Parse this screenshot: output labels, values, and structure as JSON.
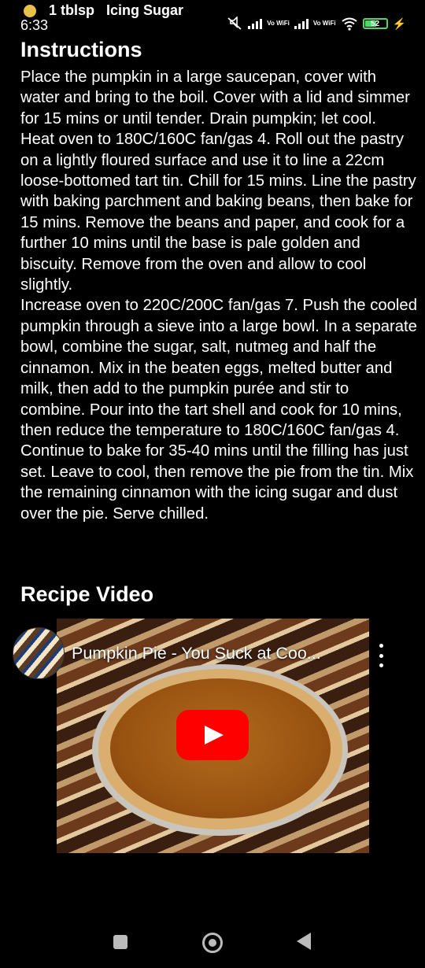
{
  "status_bar": {
    "time": "6:33",
    "notification_text": {
      "quantity": "1 tblsp",
      "item": "Icing Sugar"
    },
    "vowifi_label_1": "Vo WiFi",
    "vowifi_label_2": "Vo WiFi",
    "battery_level": "52",
    "icons": [
      "notification-dot",
      "mute-icon",
      "signal-icon",
      "signal-icon",
      "wifi-icon",
      "battery-icon",
      "charging-icon"
    ]
  },
  "instructions": {
    "title": "Instructions",
    "steps": [
      "Place the pumpkin in a large saucepan, cover with water and bring to the boil. Cover with a lid and simmer for 15 mins or until tender. Drain pumpkin; let cool.",
      "Heat oven to 180C/160C fan/gas 4. Roll out the pastry on a lightly floured surface and use it to line a 22cm loose-bottomed tart tin. Chill for 15 mins. Line the pastry with baking parchment and baking beans, then bake for 15 mins. Remove the beans and paper, and cook for a further 10 mins until the base is pale golden and biscuity. Remove from the oven and allow to cool slightly.",
      "Increase oven to 220C/200C fan/gas 7. Push the cooled pumpkin through a sieve into a large bowl. In a separate bowl, combine the sugar, salt, nutmeg and half the cinnamon. Mix in the beaten eggs, melted butter and milk, then add to the pumpkin purée and stir to combine. Pour into the tart shell and cook for 10 mins, then reduce the temperature to 180C/160C fan/gas 4. Continue to bake for 35-40 mins until the filling has just set. Leave to cool, then remove the pie from the tin. Mix the remaining cinnamon with the icing sugar and dust over the pie. Serve chilled."
    ]
  },
  "recipe_video": {
    "title": "Recipe Video",
    "video_title": "Pumpkin Pie - You Suck at Coo...",
    "icons": [
      "channel-avatar",
      "play-icon",
      "more-vert-icon"
    ]
  },
  "navigation": {
    "icons": [
      "recents-icon",
      "home-icon",
      "back-icon"
    ]
  },
  "colors": {
    "background": "#000000",
    "text": "#ffffff",
    "play_button": "#ff0000",
    "battery": "#4cd964",
    "notification_dot": "#e7c24a"
  }
}
